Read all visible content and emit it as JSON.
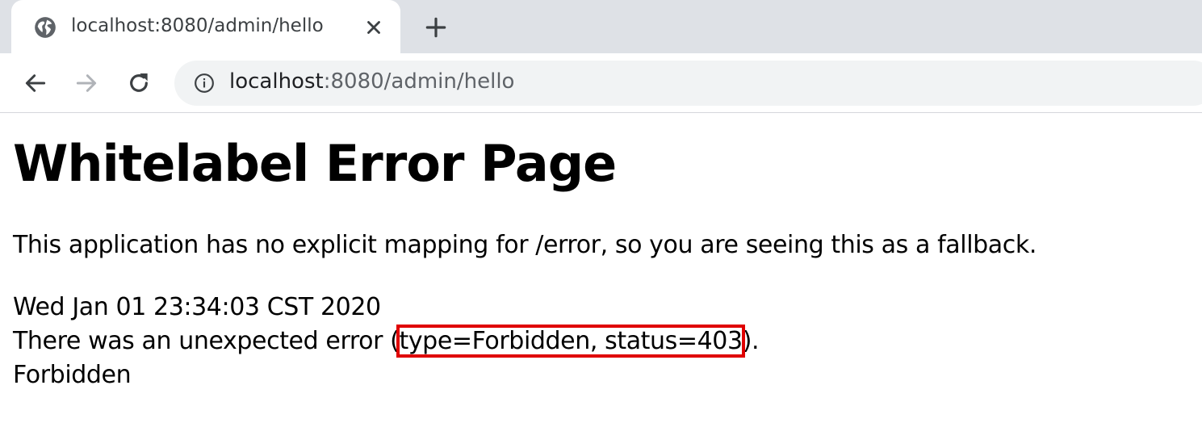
{
  "browser": {
    "tab": {
      "title": "localhost:8080/admin/hello"
    },
    "address_bar": {
      "host": "localhost",
      "path": ":8080/admin/hello"
    }
  },
  "page": {
    "title": "Whitelabel Error Page",
    "explanation": "This application has no explicit mapping for /error, so you are seeing this as a fallback.",
    "timestamp": "Wed Jan 01 23:34:03 CST 2020",
    "error_prefix": "There was an unexpected error (",
    "error_highlight": "type=Forbidden, status=403",
    "error_suffix": ").",
    "message": "Forbidden"
  },
  "colors": {
    "tabstrip": "#dee1e6",
    "omnibox": "#f1f3f4",
    "annotation_box": "#e00000"
  }
}
